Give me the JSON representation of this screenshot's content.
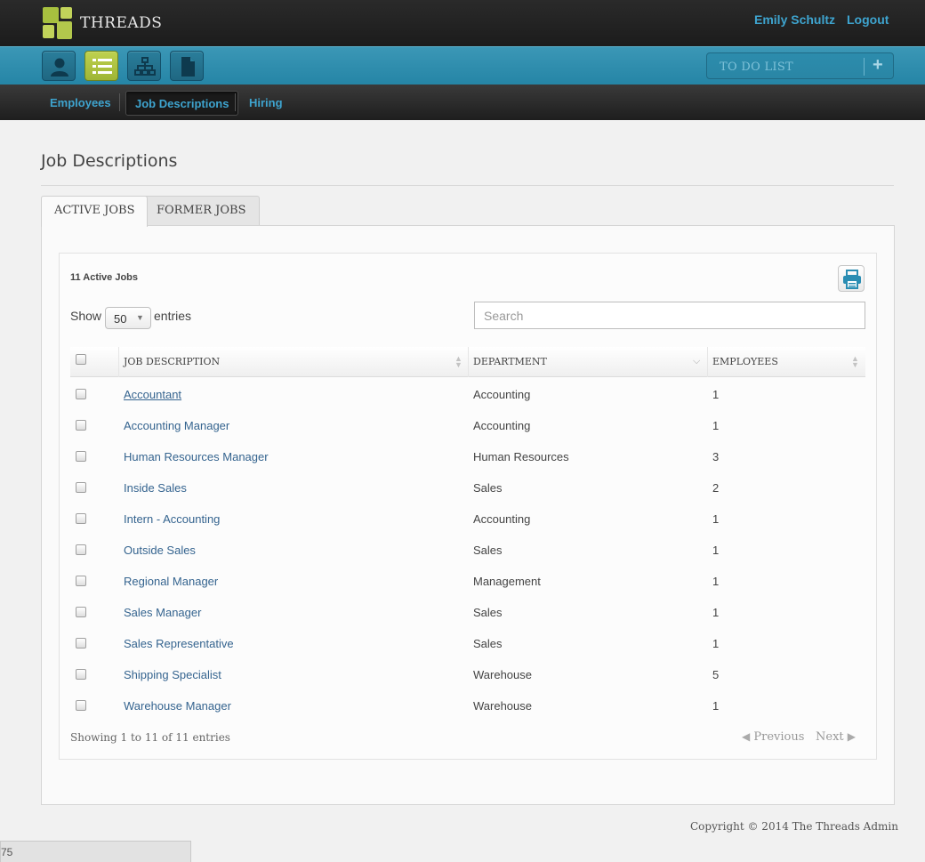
{
  "app": {
    "brand": "THREADS",
    "user_name": "Emily Schultz",
    "logout_label": "Logout",
    "todo_label": "TO DO LIST",
    "todo_plus": "+"
  },
  "toolbar": {
    "buttons": [
      {
        "icon": "person-icon",
        "active": false
      },
      {
        "icon": "list-icon",
        "active": true
      },
      {
        "icon": "org-chart-icon",
        "active": false
      },
      {
        "icon": "document-icon",
        "active": false
      }
    ]
  },
  "nav": {
    "items": [
      "Employees",
      "Job Descriptions",
      "Hiring"
    ],
    "active": "Job Descriptions"
  },
  "page": {
    "title": "Job Descriptions",
    "tabs": [
      "ACTIVE JOBS",
      "FORMER JOBS"
    ],
    "active_tab": "ACTIVE JOBS"
  },
  "table_controls": {
    "count_label": "11 Active Jobs",
    "show_label": "Show",
    "entries_value": "50",
    "entries_label": "entries",
    "search_placeholder": "Search"
  },
  "table": {
    "columns": [
      "JOB DESCRIPTION",
      "DEPARTMENT",
      "EMPLOYEES"
    ],
    "rows": [
      {
        "job": "Accountant",
        "dept": "Accounting",
        "employees": "1"
      },
      {
        "job": "Accounting Manager",
        "dept": "Accounting",
        "employees": "1"
      },
      {
        "job": "Human Resources Manager",
        "dept": "Human Resources",
        "employees": "3"
      },
      {
        "job": "Inside Sales",
        "dept": "Sales",
        "employees": "2"
      },
      {
        "job": "Intern - Accounting",
        "dept": "Accounting",
        "employees": "1"
      },
      {
        "job": "Outside Sales",
        "dept": "Sales",
        "employees": "1"
      },
      {
        "job": "Regional Manager",
        "dept": "Management",
        "employees": "1"
      },
      {
        "job": "Sales Manager",
        "dept": "Sales",
        "employees": "1"
      },
      {
        "job": "Sales Representative",
        "dept": "Sales",
        "employees": "1"
      },
      {
        "job": "Shipping Specialist",
        "dept": "Warehouse",
        "employees": "5"
      },
      {
        "job": "Warehouse Manager",
        "dept": "Warehouse",
        "employees": "1"
      }
    ]
  },
  "footer": {
    "info": "Showing 1 to 11 of 11 entries",
    "previous": "Previous",
    "next": "Next",
    "copyright": "Copyright © 2014 The Threads Admin",
    "status_text": "75"
  },
  "colors": {
    "accent": "#3ea4cf",
    "toolbar": "#2585a6",
    "active_green": "#a7c03f",
    "link": "#35648f"
  }
}
